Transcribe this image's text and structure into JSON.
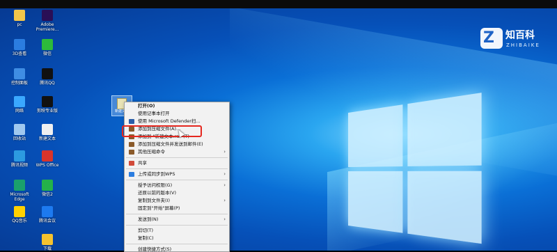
{
  "watermark": {
    "title": "知百科",
    "subtitle": "ZHIBAIKE",
    "badge": "Z"
  },
  "desktop_icons": [
    {
      "label": "pc",
      "color": "#f3c64a"
    },
    {
      "label": "Adobe Premiere...",
      "color": "#2a0f56"
    },
    {
      "label": "3D查看",
      "color": "#2b7de0"
    },
    {
      "label": "微信",
      "color": "#2dbb3b"
    },
    {
      "label": "控制面板",
      "color": "#3f8de3"
    },
    {
      "label": "腾讯QQ",
      "color": "#111111"
    },
    {
      "label": "网络",
      "color": "#3aa8ff"
    },
    {
      "label": "剪映专业版",
      "color": "#111111"
    },
    {
      "label": "回收站",
      "color": "#9fc8ef"
    },
    {
      "label": "新建文本",
      "color": "#f0f0f0"
    },
    {
      "label": "腾讯视频",
      "color": "#2c9ae0"
    },
    {
      "label": "WPS Office",
      "color": "#d8342a"
    },
    {
      "label": "Microsoft Edge",
      "color": "#1aa06c"
    },
    {
      "label": "微信2",
      "color": "#24b24a"
    },
    {
      "label": "QQ音乐",
      "color": "#ffd100"
    },
    {
      "label": "腾讯会议",
      "color": "#1d7af0"
    },
    {
      "label": "下载",
      "color": "#f5c22e"
    }
  ],
  "selected_file": {
    "label": "新建文本"
  },
  "context_menu": {
    "groups": [
      [
        {
          "label": "打开(O)",
          "bold": true,
          "icon": "",
          "arrow": false
        },
        {
          "label": "使用记事本打开",
          "icon": "",
          "arrow": false
        },
        {
          "label": "使用 Microsoft Defender扫...",
          "icon": "defender-icon",
          "icon_color": "#2b5ea8",
          "arrow": false
        },
        {
          "label": "添加到压缩文件(A)...",
          "icon": "winrar-icon",
          "icon_color": "#8a5a2a",
          "arrow": false
        },
        {
          "label": "添加到 \"新建文本.rar\"(T)",
          "icon": "winrar-icon",
          "icon_color": "#8a5a2a",
          "arrow": false
        },
        {
          "label": "添加到压缩文件并发送到邮件(E)",
          "icon": "winrar-icon",
          "icon_color": "#8a5a2a",
          "arrow": false
        },
        {
          "label": "其他压缩命令",
          "icon": "winrar-icon",
          "icon_color": "#8a5a2a",
          "arrow": true
        }
      ],
      [
        {
          "label": "共享",
          "icon": "share-icon",
          "icon_color": "#d14a3a",
          "arrow": false
        }
      ],
      [
        {
          "label": "上传或同步到WPS",
          "icon": "wps-cloud-icon",
          "icon_color": "#2b7de0",
          "arrow": true
        }
      ],
      [
        {
          "label": "授予访问权限(G)",
          "icon": "",
          "arrow": true
        },
        {
          "label": "还原以前的版本(V)",
          "icon": "",
          "arrow": false
        },
        {
          "label": "复制到文件夹(I)",
          "icon": "",
          "arrow": true
        },
        {
          "label": "固定到\"开始\"屏幕(P)",
          "icon": "",
          "arrow": false
        }
      ],
      [
        {
          "label": "发送到(N)",
          "icon": "",
          "arrow": true
        }
      ],
      [
        {
          "label": "剪切(T)",
          "icon": "",
          "arrow": false
        },
        {
          "label": "复制(C)",
          "icon": "",
          "arrow": false
        }
      ],
      [
        {
          "label": "创建快捷方式(S)",
          "icon": "",
          "arrow": false
        }
      ]
    ]
  },
  "colors": {
    "highlight_box": "#e5281f"
  }
}
